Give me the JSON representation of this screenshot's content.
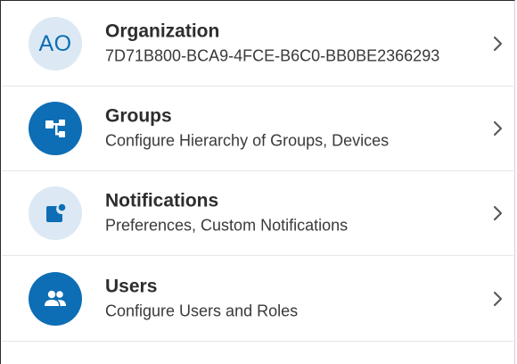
{
  "settings": {
    "items": [
      {
        "title": "Organization",
        "subtitle": "7D71B800-BCA9-4FCE-B6C0-BB0BE2366293",
        "avatar_text": "AO",
        "icon": "initials-avatar",
        "avatar_style": "light"
      },
      {
        "title": "Groups",
        "subtitle": "Configure Hierarchy of Groups, Devices",
        "icon": "hierarchy-icon",
        "avatar_style": "dark"
      },
      {
        "title": "Notifications",
        "subtitle": "Preferences, Custom Notifications",
        "icon": "notification-icon",
        "avatar_style": "light"
      },
      {
        "title": "Users",
        "subtitle": "Configure Users and Roles",
        "icon": "users-icon",
        "avatar_style": "dark"
      }
    ]
  },
  "colors": {
    "accent": "#0d6eb5",
    "avatar_light_bg": "#dce9f4",
    "divider": "#e2e6ea",
    "text_primary": "#2d2d2d",
    "chevron": "#5a5a5a"
  }
}
